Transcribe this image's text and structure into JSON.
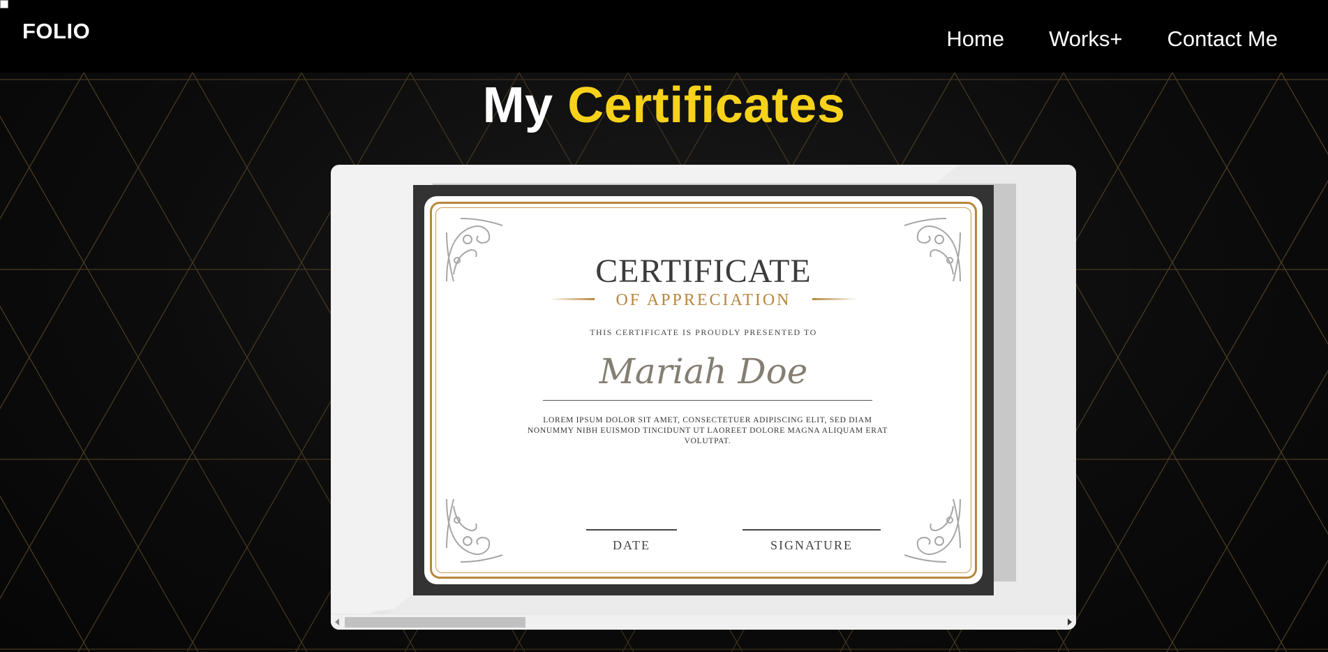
{
  "header": {
    "logo": "FOLIO",
    "nav": [
      {
        "label": "Home"
      },
      {
        "label": "Works+"
      },
      {
        "label": "Contact Me"
      }
    ]
  },
  "main": {
    "heading_white": "My",
    "heading_yellow": "Certificates",
    "certificate": {
      "title": "CERTIFICATE",
      "subtitle": "OF APPRECIATION",
      "presented": "THIS CERTIFICATE IS PROUDLY PRESENTED TO",
      "name": "Mariah Doe",
      "body": "LOREM IPSUM DOLOR SIT AMET, CONSECTETUER ADIPISCING ELIT, SED DIAM NONUMMY NIBH EUISMOD TINCIDUNT UT LAOREET DOLORE MAGNA ALIQUAM ERAT VOLUTPAT.",
      "date_label": "DATE",
      "signature_label": "SIGNATURE"
    }
  },
  "colors": {
    "accent_yellow": "#f7d21b",
    "gold": "#b8863b",
    "pattern_gold": "#8a6a3a"
  }
}
